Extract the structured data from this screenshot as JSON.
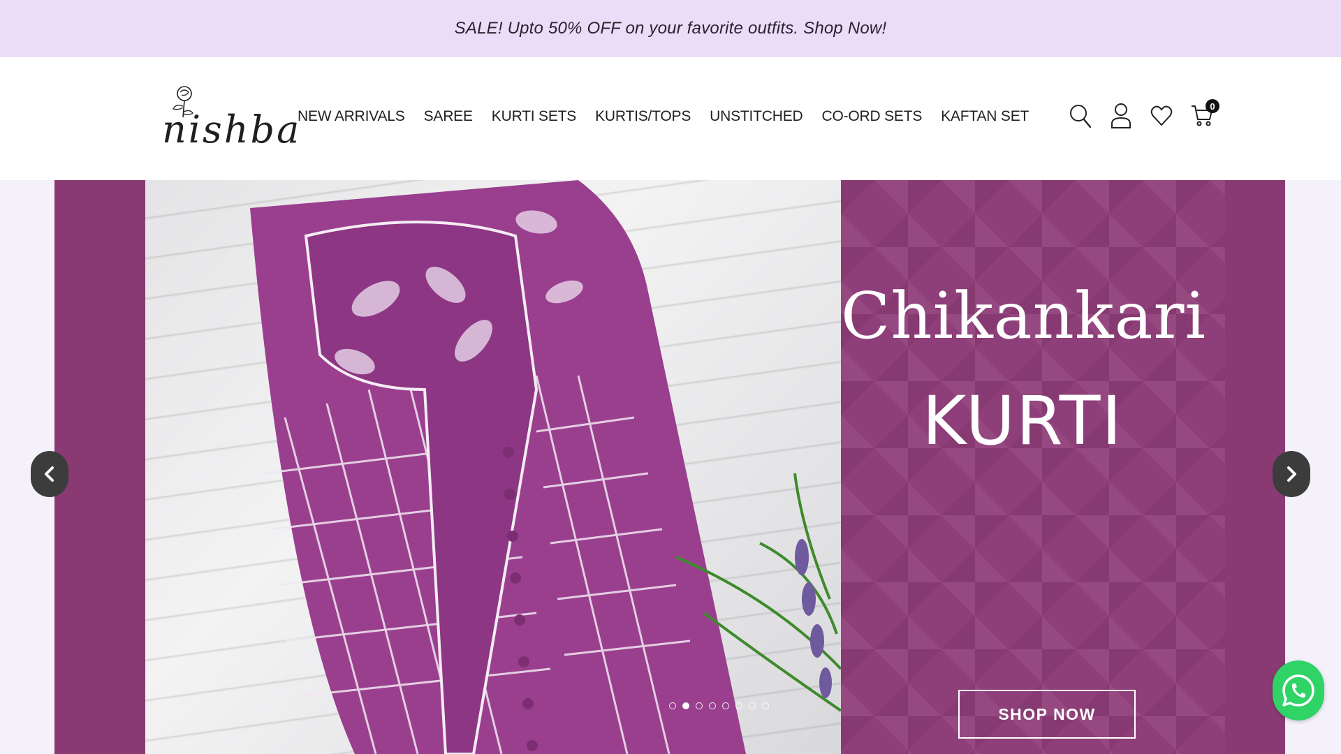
{
  "announcement": {
    "text": "SALE! Upto 50% OFF on your favorite outfits. Shop Now!"
  },
  "header": {
    "logo_text": "nishba",
    "nav": [
      {
        "label": "NEW ARRIVALS"
      },
      {
        "label": "SAREE"
      },
      {
        "label": "KURTI SETS"
      },
      {
        "label": "KURTIS/TOPS"
      },
      {
        "label": "UNSTITCHED"
      },
      {
        "label": "CO-ORD SETS"
      },
      {
        "label": "KAFTAN SET"
      }
    ],
    "icons": [
      "search-icon",
      "account-icon",
      "wishlist-icon",
      "cart-icon"
    ],
    "cart_count": "0"
  },
  "hero": {
    "headline": "Chikankari",
    "subline": "KURTI",
    "cta": "SHOP NOW",
    "slides": 8,
    "active_slide": 2,
    "colors": {
      "brand_purple": "#8a3a73",
      "announce_bg": "#ecdcf7",
      "whatsapp": "#2fd366"
    }
  }
}
